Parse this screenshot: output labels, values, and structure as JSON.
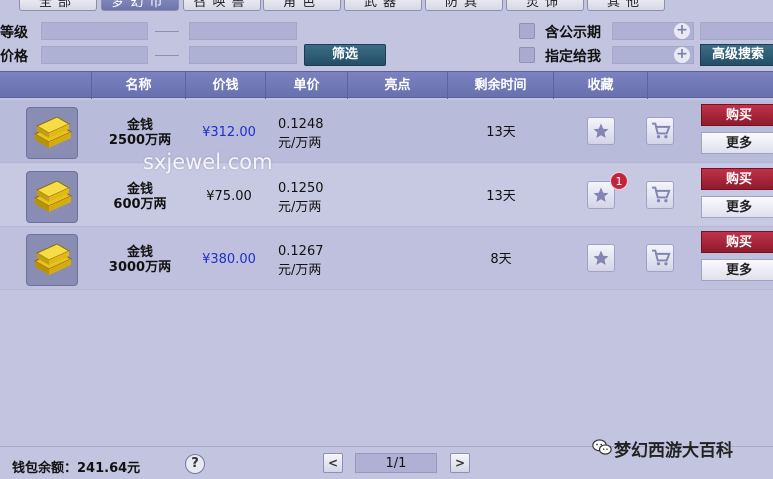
{
  "tabs": [
    {
      "label": "全部",
      "active": false
    },
    {
      "label": "梦幻币",
      "active": true
    },
    {
      "label": "召唤兽",
      "active": false
    },
    {
      "label": "角色",
      "active": false
    },
    {
      "label": "武器",
      "active": false
    },
    {
      "label": "防具",
      "active": false
    },
    {
      "label": "灵饰",
      "active": false
    },
    {
      "label": "其他",
      "active": false
    }
  ],
  "filters": {
    "level_label": "等级",
    "price_label": "价格",
    "filter_button": "筛选",
    "include_public_label": "含公示期",
    "assigned_to_me_label": "指定给我",
    "advanced_search_button": "高级搜索"
  },
  "table": {
    "headers": [
      "名称",
      "价钱",
      "单价",
      "亮点",
      "剩余时间",
      "收藏"
    ],
    "rows": [
      {
        "name_line1": "金钱",
        "name_line2": "2500万两",
        "price": "¥312.00",
        "price_highlight": true,
        "unit_line1": "0.1248",
        "unit_line2": "元/万两",
        "highlight": "",
        "time_left": "13天",
        "fav_badge": null,
        "buy": "购买",
        "more": "更多"
      },
      {
        "name_line1": "金钱",
        "name_line2": "600万两",
        "price": "¥75.00",
        "price_highlight": false,
        "unit_line1": "0.1250",
        "unit_line2": "元/万两",
        "highlight": "",
        "time_left": "13天",
        "fav_badge": "1",
        "buy": "购买",
        "more": "更多"
      },
      {
        "name_line1": "金钱",
        "name_line2": "3000万两",
        "price": "¥380.00",
        "price_highlight": true,
        "unit_line1": "0.1267",
        "unit_line2": "元/万两",
        "highlight": "",
        "time_left": "8天",
        "fav_badge": null,
        "buy": "购买",
        "more": "更多"
      }
    ]
  },
  "watermark": "sxjewel.com",
  "footer": {
    "wallet_balance": "钱包余额：241.64元",
    "help": "?",
    "prev": "<",
    "page": "1/1",
    "next": ">",
    "brand_name": "梦幻西游大百科"
  },
  "colors": {
    "background": "#c3c4e0",
    "header": "#6f77b3",
    "buy": "#a6253a",
    "filter_button": "#2d5c74",
    "price_blue": "#1f2ed0"
  }
}
